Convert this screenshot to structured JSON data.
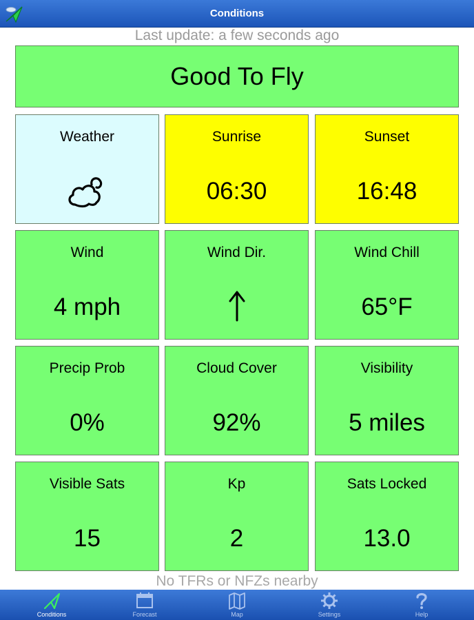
{
  "header": {
    "title": "Conditions",
    "app_icon": "drone-icon"
  },
  "last_update": "Last update: a few seconds ago",
  "status": "Good To Fly",
  "tiles": [
    {
      "label": "Weather",
      "icon": "partly-cloudy-icon",
      "color": "#dcfcfe"
    },
    {
      "label": "Sunrise",
      "value": "06:30",
      "color": "#fefe00"
    },
    {
      "label": "Sunset",
      "value": "16:48",
      "color": "#fefe00"
    },
    {
      "label": "Wind",
      "value": "4 mph",
      "color": "#77fe73"
    },
    {
      "label": "Wind Dir.",
      "icon": "arrow-up-icon",
      "color": "#77fe73"
    },
    {
      "label": "Wind Chill",
      "value": "65°F",
      "color": "#77fe73"
    },
    {
      "label": "Precip Prob",
      "value": "0%",
      "color": "#77fe73"
    },
    {
      "label": "Cloud Cover",
      "value": "92%",
      "color": "#77fe73"
    },
    {
      "label": "Visibility",
      "value": "5 miles",
      "color": "#77fe73"
    },
    {
      "label": "Visible Sats",
      "value": "15",
      "color": "#77fe73"
    },
    {
      "label": "Kp",
      "value": "2",
      "color": "#77fe73"
    },
    {
      "label": "Sats Locked",
      "value": "13.0",
      "color": "#77fe73"
    }
  ],
  "footer_note": "No TFRs or NFZs nearby",
  "tabs": [
    {
      "label": "Conditions",
      "icon": "paper-plane-icon",
      "active": true
    },
    {
      "label": "Forecast",
      "icon": "calendar-icon",
      "active": false
    },
    {
      "label": "Map",
      "icon": "map-icon",
      "active": false
    },
    {
      "label": "Settings",
      "icon": "gear-icon",
      "active": false
    },
    {
      "label": "Help",
      "icon": "question-icon",
      "active": false
    }
  ]
}
